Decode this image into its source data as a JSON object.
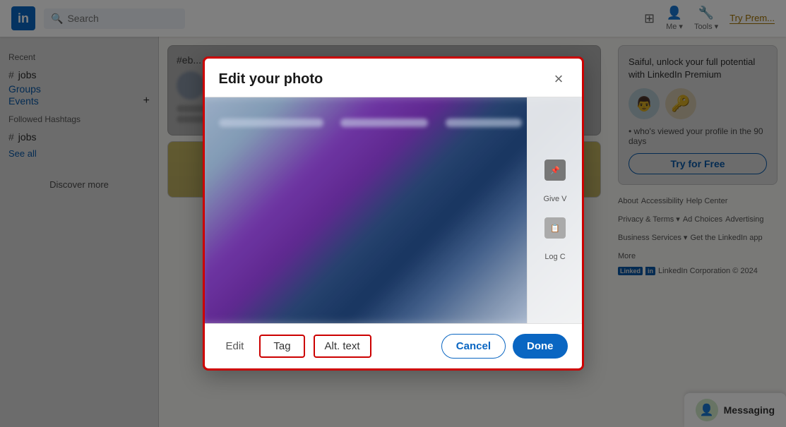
{
  "nav": {
    "logo": "in",
    "search_placeholder": "Search",
    "nav_items": [
      "Me ▾",
      "Tools ▾"
    ],
    "try_premium": "Try Prem..."
  },
  "sidebar": {
    "recent_label": "Recent",
    "recent_items": [
      {
        "label": "jobs",
        "hash": "#"
      }
    ],
    "groups_label": "Groups",
    "events_label": "Events",
    "events_add": "+",
    "followed_label": "Followed Hashtags",
    "followed_items": [
      {
        "label": "jobs",
        "hash": "#"
      }
    ],
    "see_all": "See all",
    "discover_more": "Discover more"
  },
  "feed": {
    "post_placeholder": "#eb..."
  },
  "right_sidebar": {
    "premium_title": "Saiful, unlock your full potential with LinkedIn Premium",
    "premium_desc": "• who's viewed your profile in the 90 days",
    "try_free_label": "Try for Free",
    "footer_links": [
      "About",
      "Accessibility",
      "Help Center",
      "Privacy & Terms ▾",
      "Ad Choices",
      "Advertising",
      "Business Services ▾",
      "Get the LinkedIn app",
      "More"
    ],
    "footer_brand": "LinkedIn",
    "footer_corp": "LinkedIn Corporation © 2024"
  },
  "messaging": {
    "label": "Messaging"
  },
  "modal": {
    "title": "Edit your photo",
    "close_label": "×",
    "actions": {
      "edit_label": "Edit",
      "tag_label": "Tag",
      "alt_label": "Alt. text"
    },
    "give_label": "Give V",
    "log_label": "Log C",
    "cancel_label": "Cancel",
    "done_label": "Done"
  }
}
